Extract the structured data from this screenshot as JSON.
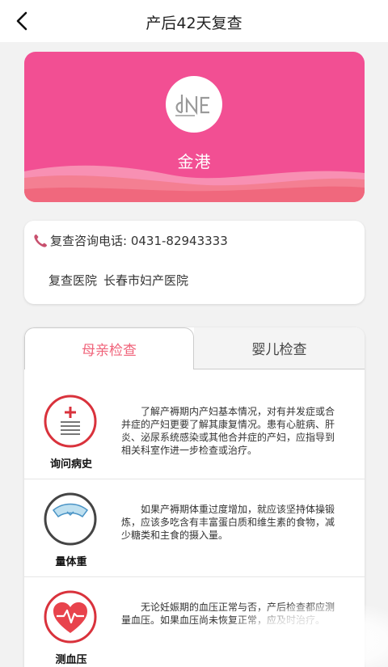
{
  "nav": {
    "title": "产后42天复查"
  },
  "hero": {
    "logo_text": "dNE",
    "name": "金港"
  },
  "info": {
    "phone_label": "复查咨询电话: 0431-82943333",
    "hospital_label": "复查医院",
    "hospital_name": "长春市妇产医院"
  },
  "tabs": [
    {
      "label": "母亲检查",
      "active": true
    },
    {
      "label": "婴儿检查",
      "active": false
    }
  ],
  "items": [
    {
      "icon": "medical-history-icon",
      "label": "询问病史",
      "desc": "了解产褥期内产妇基本情况，对有并发症或合并症的产妇更要了解其康复情况。患有心脏病、肝炎、泌尿系统感染或其他合并症的产妇，应指导到相关科室作进一步检查或治疗。"
    },
    {
      "icon": "scale-icon",
      "label": "量体重",
      "desc": "如果产褥期体重过度增加，就应该坚持体操锻炼，应该多吃含有丰富蛋白质和维生素的食物，减少糖类和主食的摄入量。"
    },
    {
      "icon": "heart-pulse-icon",
      "label": "测血压",
      "desc": "无论妊娠期的血压正常与否，产后检查都应测量血压。如果血压尚未恢复正常，应及时治疗。"
    }
  ],
  "colors": {
    "brand_pink": "#f24f93",
    "tab_active": "#f0637a",
    "icon_red": "#d9323c"
  }
}
